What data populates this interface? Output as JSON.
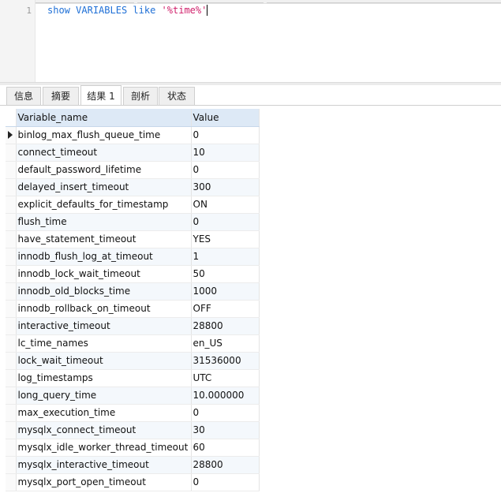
{
  "editor": {
    "line_number": "1",
    "kw_show": "show",
    "kw_variables": "VARIABLES",
    "kw_like": "like",
    "string": "'%time%'"
  },
  "tabs": [
    {
      "label": "信息"
    },
    {
      "label": "摘要"
    },
    {
      "label": "结果 1"
    },
    {
      "label": "剖析"
    },
    {
      "label": "状态"
    }
  ],
  "active_tab": "结果 1",
  "grid": {
    "headers": {
      "name": "Variable_name",
      "value": "Value"
    },
    "rows": [
      {
        "name": "binlog_max_flush_queue_time",
        "value": "0"
      },
      {
        "name": "connect_timeout",
        "value": "10"
      },
      {
        "name": "default_password_lifetime",
        "value": "0"
      },
      {
        "name": "delayed_insert_timeout",
        "value": "300"
      },
      {
        "name": "explicit_defaults_for_timestamp",
        "value": "ON"
      },
      {
        "name": "flush_time",
        "value": "0"
      },
      {
        "name": "have_statement_timeout",
        "value": "YES"
      },
      {
        "name": "innodb_flush_log_at_timeout",
        "value": "1"
      },
      {
        "name": "innodb_lock_wait_timeout",
        "value": "50"
      },
      {
        "name": "innodb_old_blocks_time",
        "value": "1000"
      },
      {
        "name": "innodb_rollback_on_timeout",
        "value": "OFF"
      },
      {
        "name": "interactive_timeout",
        "value": "28800"
      },
      {
        "name": "lc_time_names",
        "value": "en_US"
      },
      {
        "name": "lock_wait_timeout",
        "value": "31536000"
      },
      {
        "name": "log_timestamps",
        "value": "UTC"
      },
      {
        "name": "long_query_time",
        "value": "10.000000"
      },
      {
        "name": "max_execution_time",
        "value": "0"
      },
      {
        "name": "mysqlx_connect_timeout",
        "value": "30"
      },
      {
        "name": "mysqlx_idle_worker_thread_timeout",
        "value": "60"
      },
      {
        "name": "mysqlx_interactive_timeout",
        "value": "28800"
      },
      {
        "name": "mysqlx_port_open_timeout",
        "value": "0"
      }
    ]
  },
  "colors": {
    "keyword": "#1e6fd6",
    "string": "#d0206b",
    "header_bg": "#dde9f6"
  }
}
